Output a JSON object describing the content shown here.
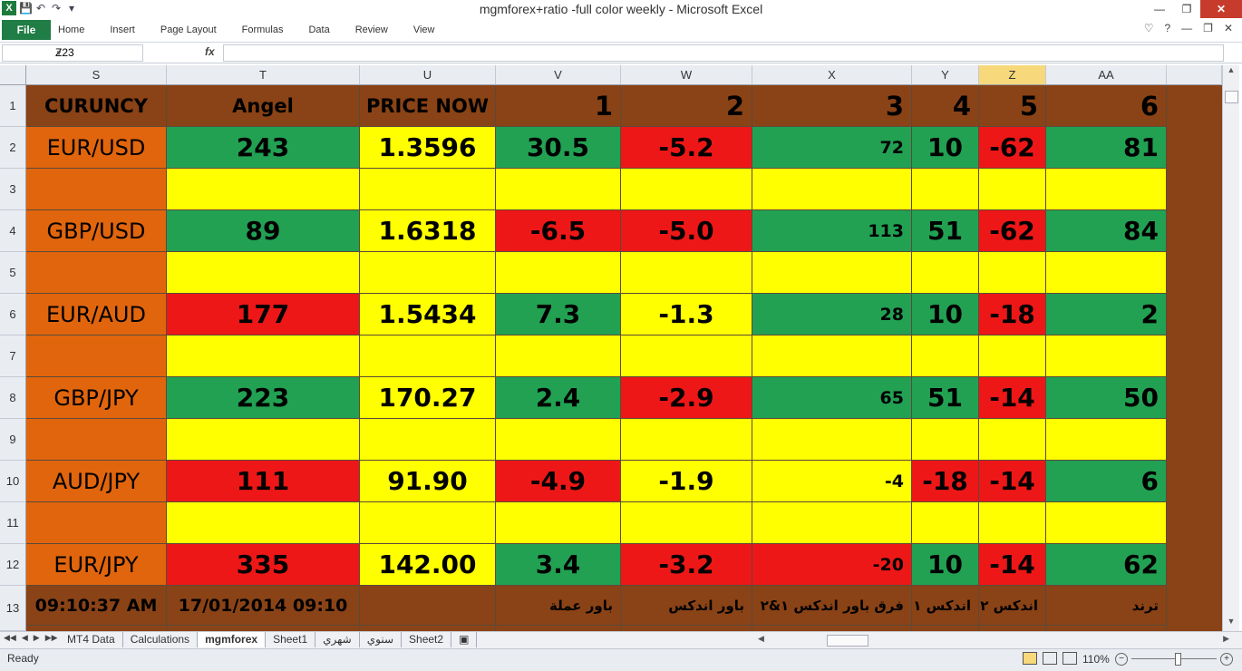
{
  "window": {
    "title": "mgmforex+ratio -full color weekly  -  Microsoft Excel"
  },
  "ribbon": {
    "file_label": "File",
    "tabs": [
      "Home",
      "Insert",
      "Page Layout",
      "Formulas",
      "Data",
      "Review",
      "View"
    ]
  },
  "formula_bar": {
    "name_box": "Z23",
    "fx": "fx",
    "formula": ""
  },
  "columns": [
    "S",
    "T",
    "U",
    "V",
    "W",
    "X",
    "Y",
    "Z",
    "AA"
  ],
  "selected_column": "Z",
  "rows": [
    "1",
    "2",
    "3",
    "4",
    "5",
    "6",
    "7",
    "8",
    "9",
    "10",
    "11",
    "12",
    "13"
  ],
  "header_row": [
    "CURUNCY",
    "Angel",
    "PRICE NOW",
    "1",
    "2",
    "3",
    "4",
    "5",
    "6"
  ],
  "pairs": [
    {
      "name": "EUR/USD",
      "angel": "243",
      "price": "1.3596",
      "c1": "30.5",
      "c2": "-5.2",
      "c3": "72",
      "c4": "10",
      "c5": "-62",
      "c6": "81"
    },
    {
      "name": "GBP/USD",
      "angel": "89",
      "price": "1.6318",
      "c1": "-6.5",
      "c2": "-5.0",
      "c3": "113",
      "c4": "51",
      "c5": "-62",
      "c6": "84"
    },
    {
      "name": "EUR/AUD",
      "angel": "177",
      "price": "1.5434",
      "c1": "7.3",
      "c2": "-1.3",
      "c3": "28",
      "c4": "10",
      "c5": "-18",
      "c6": "2"
    },
    {
      "name": "GBP/JPY",
      "angel": "223",
      "price": "170.27",
      "c1": "2.4",
      "c2": "-2.9",
      "c3": "65",
      "c4": "51",
      "c5": "-14",
      "c6": "50"
    },
    {
      "name": "AUD/JPY",
      "angel": "111",
      "price": "91.90",
      "c1": "-4.9",
      "c2": "-1.9",
      "c3": "-4",
      "c4": "-18",
      "c5": "-14",
      "c6": "6"
    },
    {
      "name": "EUR/JPY",
      "angel": "335",
      "price": "142.00",
      "c1": "3.4",
      "c2": "-3.2",
      "c3": "-20",
      "c4": "10",
      "c5": "-14",
      "c6": "62"
    }
  ],
  "footer_row": {
    "time": "09:10:37 AM",
    "datetime": "17/01/2014 09:10",
    "u": "",
    "v": "باور عملة",
    "w": "باور اندكس",
    "x": "فرق باور اندكس ١&٢",
    "y": "اندكس ١",
    "z": "اندكس ٢",
    "aa": "ترند"
  },
  "sheet_tabs": [
    "MT4 Data",
    "Calculations",
    "mgmforex",
    "Sheet1",
    "شهري",
    "سنوي",
    "Sheet2"
  ],
  "active_sheet": "mgmforex",
  "status": {
    "ready": "Ready",
    "zoom": "110%"
  },
  "colors": {
    "brown": "#8a4316",
    "orange": "#e1650d",
    "green": "#22a153",
    "red": "#ee1717",
    "yellow": "#ffff00"
  }
}
